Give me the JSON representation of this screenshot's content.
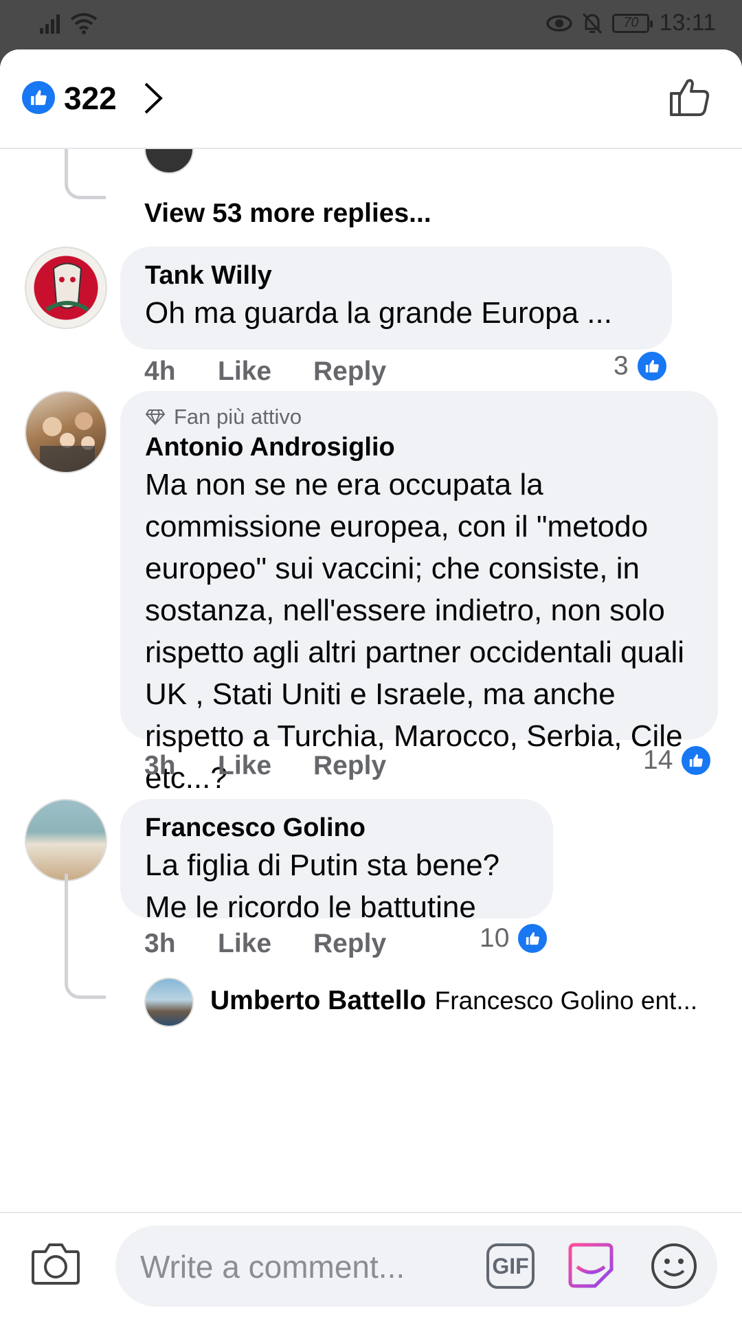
{
  "status_bar": {
    "time": "13:11",
    "battery": "70"
  },
  "header": {
    "like_count": "322"
  },
  "thread": {
    "view_more": "View 53 more replies..."
  },
  "comments": [
    {
      "author": "Tank Willy",
      "text": "Oh ma guarda la grande Europa ...",
      "time": "4h",
      "like_label": "Like",
      "reply_label": "Reply",
      "reactions": "3"
    },
    {
      "badge": "Fan più attivo",
      "author": "Antonio Androsiglio",
      "text": "Ma non se ne era occupata la commissione europea, con il \"metodo europeo\" sui vaccini; che consiste, in sostanza, nell'essere indietro, non solo rispetto agli altri partner occidentali quali UK , Stati Uniti e Israele, ma anche rispetto a Turchia, Marocco, Serbia, Cile etc...?",
      "time": "3h",
      "like_label": "Like",
      "reply_label": "Reply",
      "reactions": "14"
    },
    {
      "author": "Francesco Golino",
      "text": "La figlia di Putin sta bene? Me le ricordo le battutine",
      "time": "3h",
      "like_label": "Like",
      "reply_label": "Reply",
      "reactions": "10",
      "reply_preview": {
        "author": "Umberto Battello",
        "text": "Francesco Golino ent..."
      }
    }
  ],
  "composer": {
    "placeholder": "Write a comment...",
    "gif_label": "GIF"
  },
  "colors": {
    "accent": "#1877f2",
    "bubble": "#f0f2f5",
    "muted": "#65676b"
  }
}
